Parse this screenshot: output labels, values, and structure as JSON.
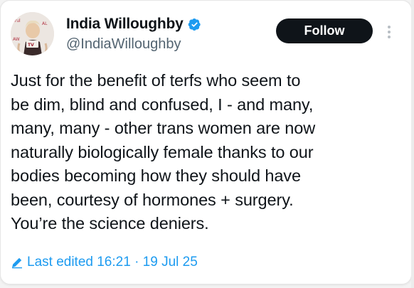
{
  "author": {
    "display_name": "India Willoughby",
    "handle": "@IndiaWilloughby",
    "verified": true,
    "verified_color": "#1d9bf0"
  },
  "follow_button": {
    "label": "Follow",
    "bg_color": "#0f1419",
    "text_color": "#ffffff"
  },
  "more_options_icon": "three-dots-vertical",
  "tweet": {
    "text": "Just for the benefit of terfs who seem to\nbe dim, blind and confused, I - and many,\nmany, many - other trans women are now\nnaturally biologically female thanks to our\nbodies becoming how they should have\nbeen, courtesy of hormones + surgery.\nYou’re the science deniers."
  },
  "edit_info": {
    "icon": "pencil-icon",
    "label": "Last edited 16:21 · 19 Jul 25",
    "color": "#1d9bf0"
  }
}
